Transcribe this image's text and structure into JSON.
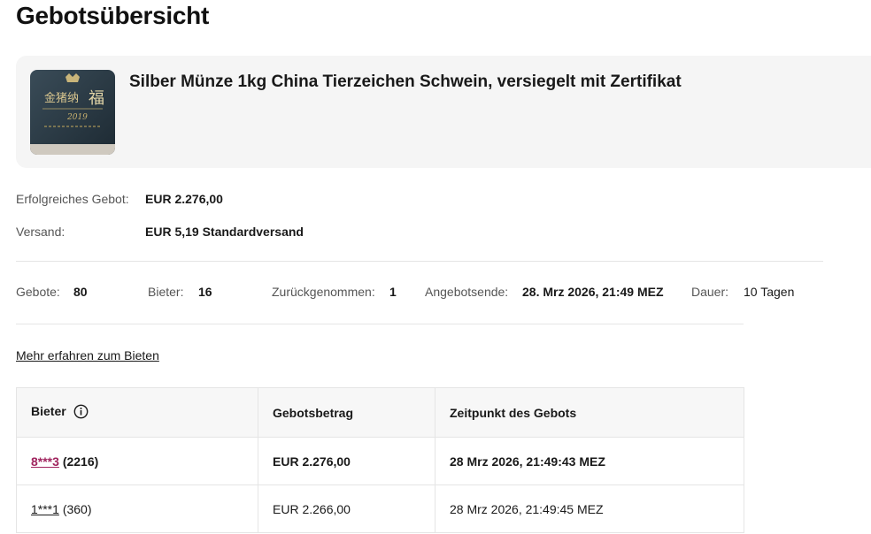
{
  "page": {
    "title": "Gebotsübersicht"
  },
  "item": {
    "title": "Silber Münze 1kg China Tierzeichen Schwein, versiegelt mit Zertifikat",
    "image_icon": "coin-box-photo"
  },
  "summary": {
    "winning_bid_label": "Erfolgreiches Gebot:",
    "winning_bid_value": "EUR 2.276,00",
    "shipping_label": "Versand:",
    "shipping_value": "EUR 5,19 Standardversand"
  },
  "stats": {
    "bids_label": "Gebote:",
    "bids_value": "80",
    "bidders_label": "Bieter:",
    "bidders_value": "16",
    "retracted_label": "Zurückgenommen:",
    "retracted_value": "1",
    "end_label": "Angebotsende:",
    "end_value": "28. Mrz 2026, 21:49 MEZ",
    "duration_label": "Dauer:",
    "duration_value": "10 Tagen"
  },
  "learn_more": "Mehr erfahren zum Bieten",
  "table": {
    "headers": {
      "bidder": "Bieter",
      "amount": "Gebotsbetrag",
      "time": "Zeitpunkt des Gebots"
    },
    "rows": [
      {
        "bidder": "8***3",
        "score": "(2216)",
        "amount": "EUR 2.276,00",
        "time": "28 Mrz 2026, 21:49:43 MEZ"
      },
      {
        "bidder": "1***1",
        "score": "(360)",
        "amount": "EUR 2.266,00",
        "time": "28 Mrz 2026, 21:49:45 MEZ"
      }
    ]
  },
  "colors": {
    "winner_link": "#a0245e",
    "card_bg": "#f5f5f5"
  }
}
